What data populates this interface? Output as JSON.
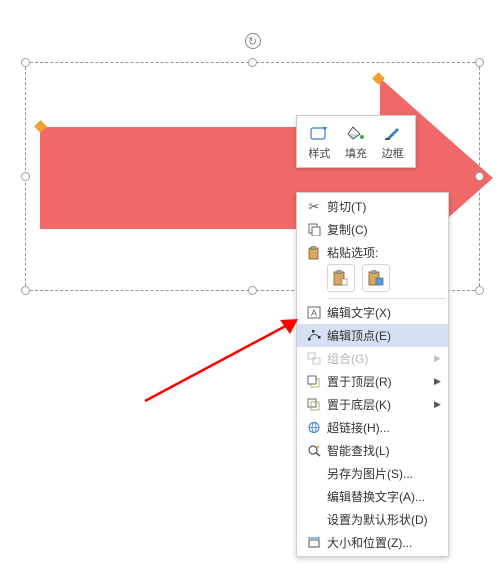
{
  "shape": {
    "type": "right-arrow",
    "fill": "#f06968",
    "stroke": "none"
  },
  "mini_toolbar": {
    "style_label": "样式",
    "fill_label": "填充",
    "outline_label": "边框"
  },
  "context_menu": {
    "cut": "剪切(T)",
    "copy": "复制(C)",
    "paste_options": "粘贴选项:",
    "edit_text": "编辑文字(X)",
    "edit_points": "编辑顶点(E)",
    "group": "组合(G)",
    "bring_front": "置于顶层(R)",
    "send_back": "置于底层(K)",
    "hyperlink": "超链接(H)...",
    "smart_lookup": "智能查找(L)",
    "save_as_picture": "另存为图片(S)...",
    "edit_alt_text": "编辑替换文字(A)...",
    "set_default_shape": "设置为默认形状(D)",
    "size_position": "大小和位置(Z)..."
  }
}
